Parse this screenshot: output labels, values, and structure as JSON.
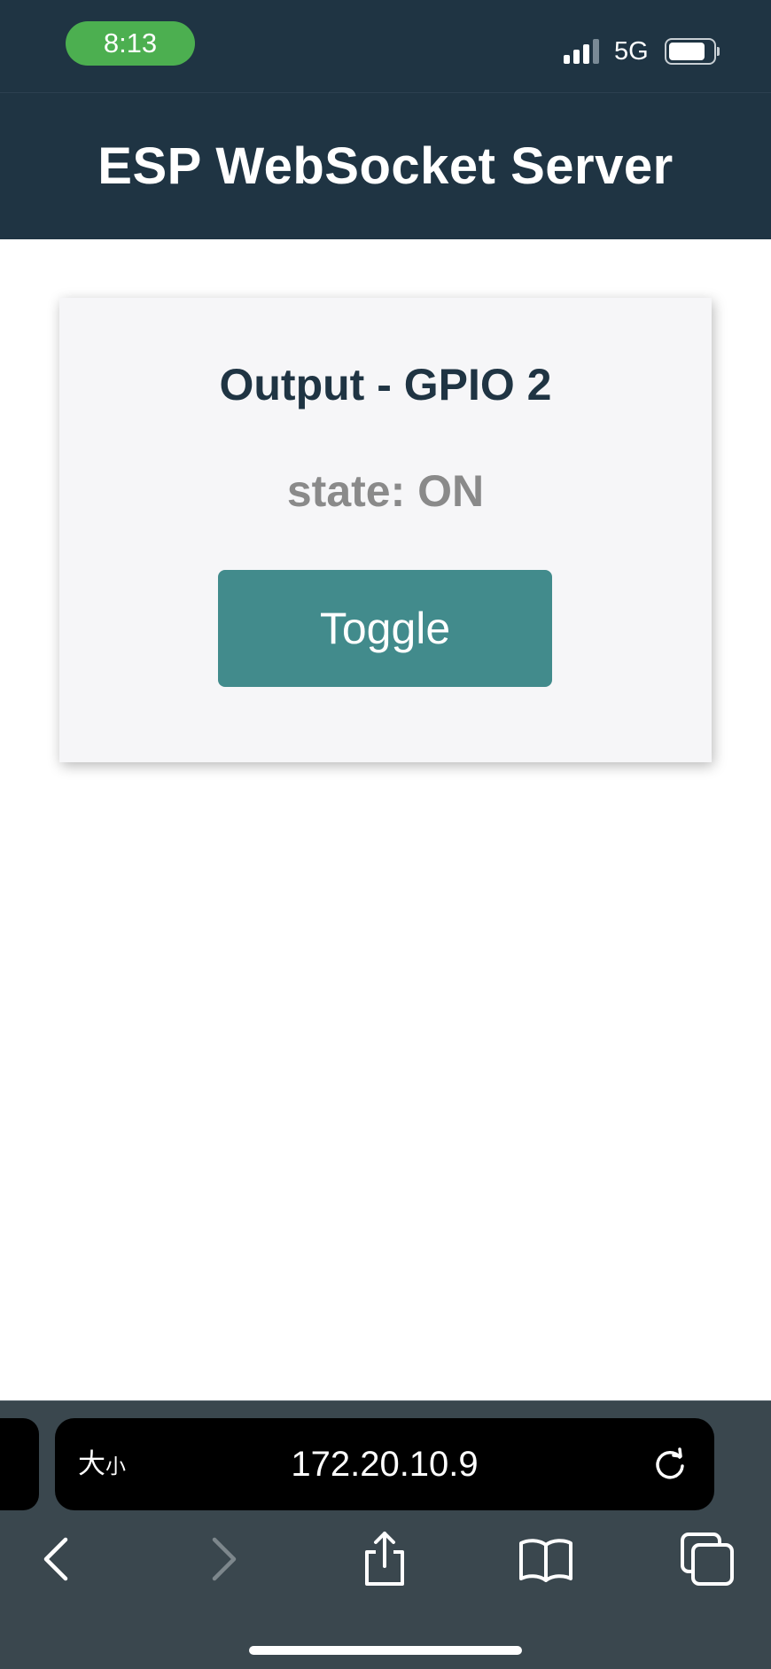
{
  "status_bar": {
    "time": "8:13",
    "network": "5G",
    "time_pill_color": "#4caf50",
    "signal_bars": 3,
    "signal_bars_total": 4
  },
  "header": {
    "title": "ESP WebSocket Server",
    "background_color": "#1f3443"
  },
  "card": {
    "title": "Output - GPIO 2",
    "state_text": "state: ON",
    "button_label": "Toggle",
    "button_color": "#428b8c"
  },
  "browser": {
    "text_size_label_big": "大",
    "text_size_label_small": "小",
    "url": "172.20.10.9",
    "icons": [
      "reload-icon",
      "back-icon",
      "forward-icon",
      "share-icon",
      "bookmarks-icon",
      "tabs-icon"
    ]
  }
}
